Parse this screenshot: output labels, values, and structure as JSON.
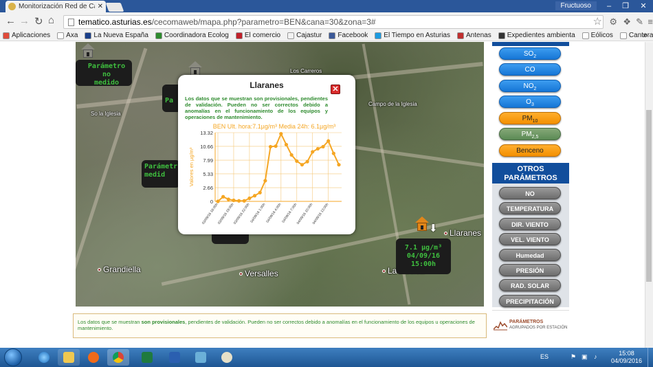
{
  "browser": {
    "tab_title": "Monitorización Red de Ca",
    "tab_close": "✕",
    "user_name": "Fructuoso",
    "url_host": "tematico.asturias.es",
    "url_path": "/cecomaweb/mapa.php?parametro=BEN&cana=30&zona=3#",
    "bookmarks": [
      {
        "label": "Aplicaciones",
        "color": "#e04a3a"
      },
      {
        "label": "Axa",
        "color": "#ffffff"
      },
      {
        "label": "La Nueva España",
        "color": "#1a3f8a"
      },
      {
        "label": "Coordinadora Ecolog",
        "color": "#2e8b2e"
      },
      {
        "label": "El comercio",
        "color": "#c0202a"
      },
      {
        "label": "Cajastur",
        "color": "#f2f2f2"
      },
      {
        "label": "Facebook",
        "color": "#3b5998"
      },
      {
        "label": "El Tiempo en Asturias",
        "color": "#1d9be0"
      },
      {
        "label": "Antenas",
        "color": "#c03030"
      },
      {
        "label": "Expedientes ambienta",
        "color": "#333333"
      },
      {
        "label": "Eólicos",
        "color": "#ffffff"
      },
      {
        "label": "Canteras Asturias",
        "color": "#ffffff"
      }
    ],
    "bookmarks_more": "»"
  },
  "map": {
    "labels": [
      {
        "text": "Los Carreros",
        "size": "small"
      },
      {
        "text": "So la Iglesia",
        "size": "small"
      },
      {
        "text": "Campo de la Iglesia",
        "size": "small"
      },
      {
        "text": "Llaranes",
        "size": "big"
      },
      {
        "text": "Grandiella",
        "size": "big"
      },
      {
        "text": "Versalles",
        "size": "big"
      },
      {
        "text": "La Rocica",
        "size": "big"
      }
    ],
    "infoboxes": [
      {
        "lines": [
          "Parámetro no",
          "medido"
        ]
      },
      {
        "lines": [
          "Pa"
        ]
      },
      {
        "lines": [
          "Parámetr",
          "medid"
        ]
      },
      {
        "lines": [
          "7.1 µg/m³",
          "04/09/16",
          "15:00h"
        ]
      }
    ]
  },
  "popup": {
    "title": "Llaranes",
    "close": "✕",
    "note": "Los datos que se muestran son provisionales, pendientes de validación. Pueden no ser correctos debido a anomalías en el funcionamiento de los equipos y operaciones de mantenimiento."
  },
  "chart_data": {
    "type": "line",
    "title": "BEN Ult. hora:7.1µg/m³ Media 24h: 6.1µg/m³",
    "ylabel": "Valores en µg/m³",
    "xlabel": "",
    "ylim": [
      0,
      13.32
    ],
    "yticks": [
      "0",
      "2.66",
      "5.33",
      "7.99",
      "10.66",
      "13.32"
    ],
    "xticks": [
      "03/09/16 16:00h",
      "03/09/16 19:00h",
      "03/09/16 22:00h",
      "04/09/16 1:00h",
      "04/09/16 4:00h",
      "04/09/16 7:00h",
      "04/09/16 10:00h",
      "04/09/16 13:00h"
    ],
    "grid": true,
    "color": "#f5a623",
    "values": [
      0.0,
      0.9,
      0.4,
      0.2,
      0.1,
      0.1,
      0.6,
      1.1,
      1.7,
      4.0,
      10.6,
      10.7,
      13.1,
      11.0,
      9.0,
      7.8,
      7.1,
      7.7,
      9.6,
      10.2,
      10.6,
      11.7,
      9.3,
      7.1
    ],
    "color_hex": "#f5a623"
  },
  "panel": {
    "pollutants": [
      {
        "base": "SO",
        "sub": "2",
        "style": "blue"
      },
      {
        "base": "CO",
        "sub": "",
        "style": "blue"
      },
      {
        "base": "NO",
        "sub": "2",
        "style": "blue"
      },
      {
        "base": "O",
        "sub": "3",
        "style": "blue"
      },
      {
        "base": "PM",
        "sub": "10",
        "style": "orange"
      },
      {
        "base": "PM",
        "sub": "2,5",
        "style": "green"
      },
      {
        "base": "Benceno",
        "sub": "",
        "style": "orange"
      }
    ],
    "otros_title": "OTROS PARÁMETROS",
    "otros": [
      "NO",
      "TEMPERATURA",
      "DIR. VIENTO",
      "VEL. VIENTO",
      "Humedad",
      "PRESIÓN",
      "RAD. SOLAR",
      "PRECIPITACIÓN"
    ],
    "logo_title": "PARÁMETROS",
    "logo_sub": "AGRUPADOS POR ESTACIÓN"
  },
  "notice": {
    "prefix": "Los datos que se muestran ",
    "bold": "son provisionales",
    "suffix": ", pendientes de validación. Pueden no ser correctos debido a anomalías en el funcionamiento de los equipos u operaciones de mantenimiento."
  },
  "taskbar": {
    "lang": "ES",
    "time": "15:08",
    "date": "04/09/2016"
  }
}
